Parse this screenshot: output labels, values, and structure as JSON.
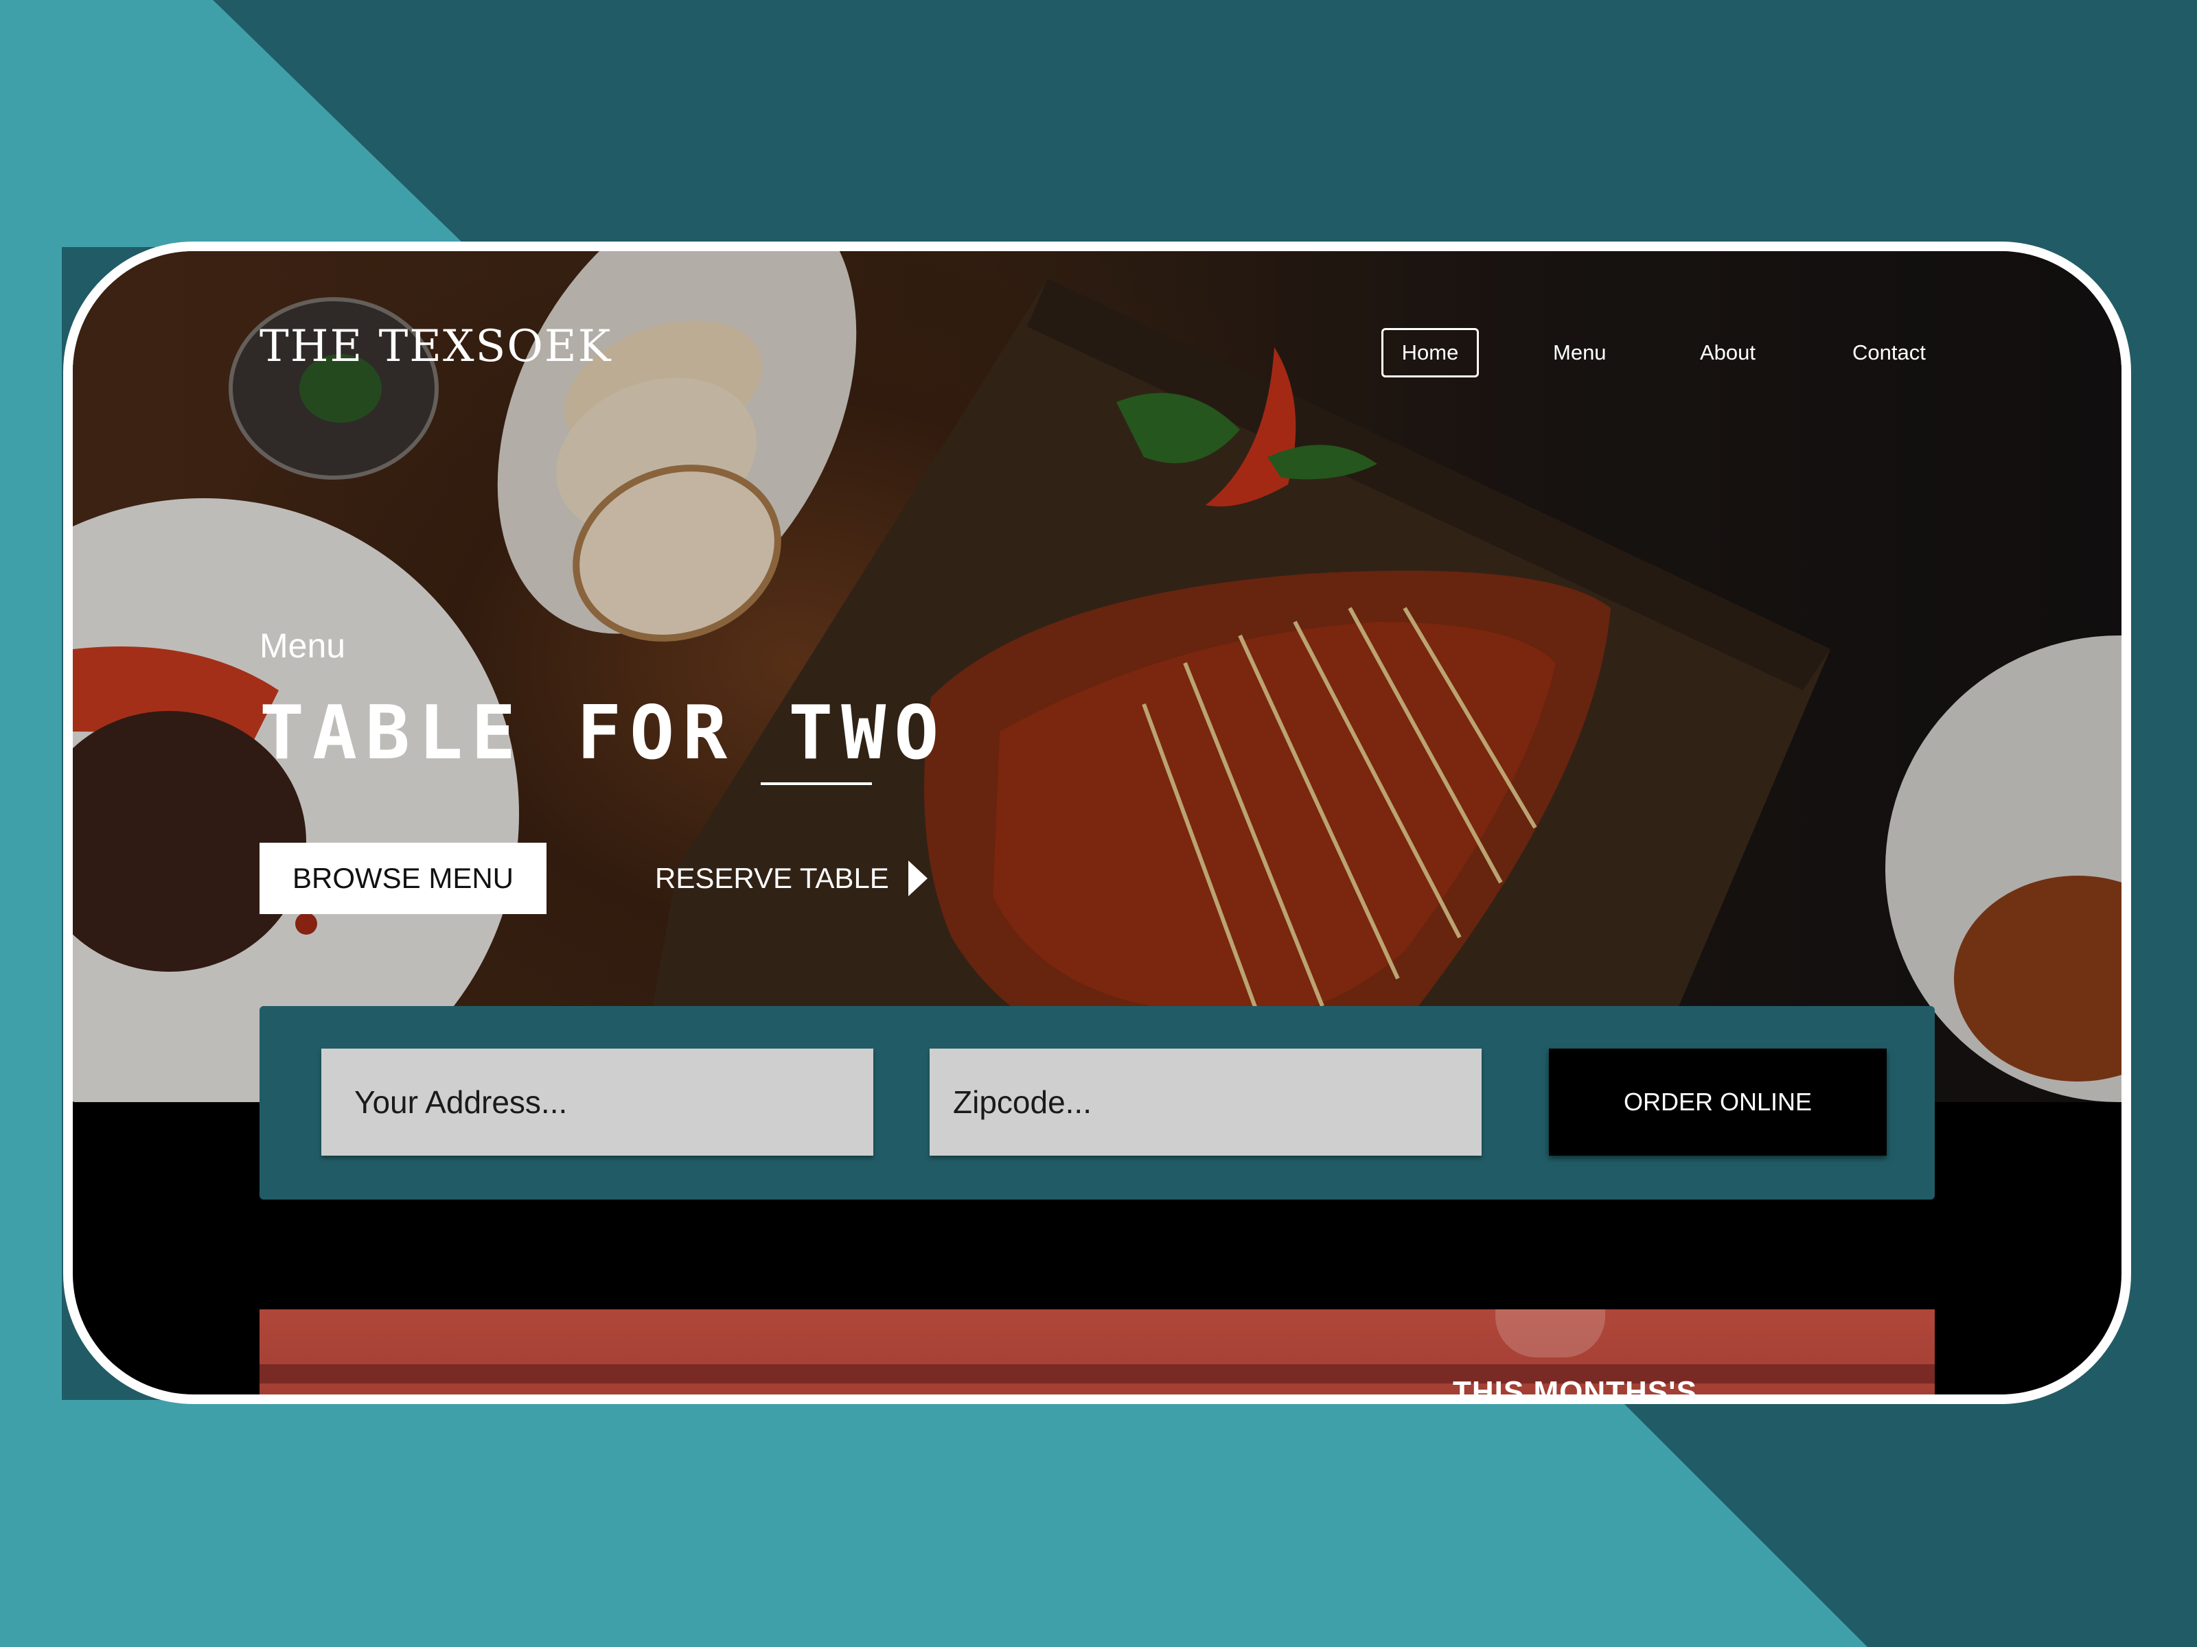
{
  "brand": "THE TEXSOEK",
  "nav": {
    "home": "Home",
    "menu": "Menu",
    "about": "About",
    "contact": "Contact"
  },
  "hero": {
    "eyebrow": "Menu",
    "headline": "TABLE FOR TWO",
    "browse_label": "BROWSE MENU",
    "reserve_label": "RESERVE TABLE"
  },
  "order": {
    "address_placeholder": "Your Address...",
    "zip_placeholder": "Zipcode...",
    "button_label": "ORDER ONLINE"
  },
  "feature": {
    "title": "THIS MONTHS'S"
  },
  "colors": {
    "teal_dark": "#215c66",
    "teal_light": "#40a0aa",
    "panel": "#215c66",
    "button_dark": "#000000"
  },
  "icons": [
    "play-triangle-icon"
  ]
}
